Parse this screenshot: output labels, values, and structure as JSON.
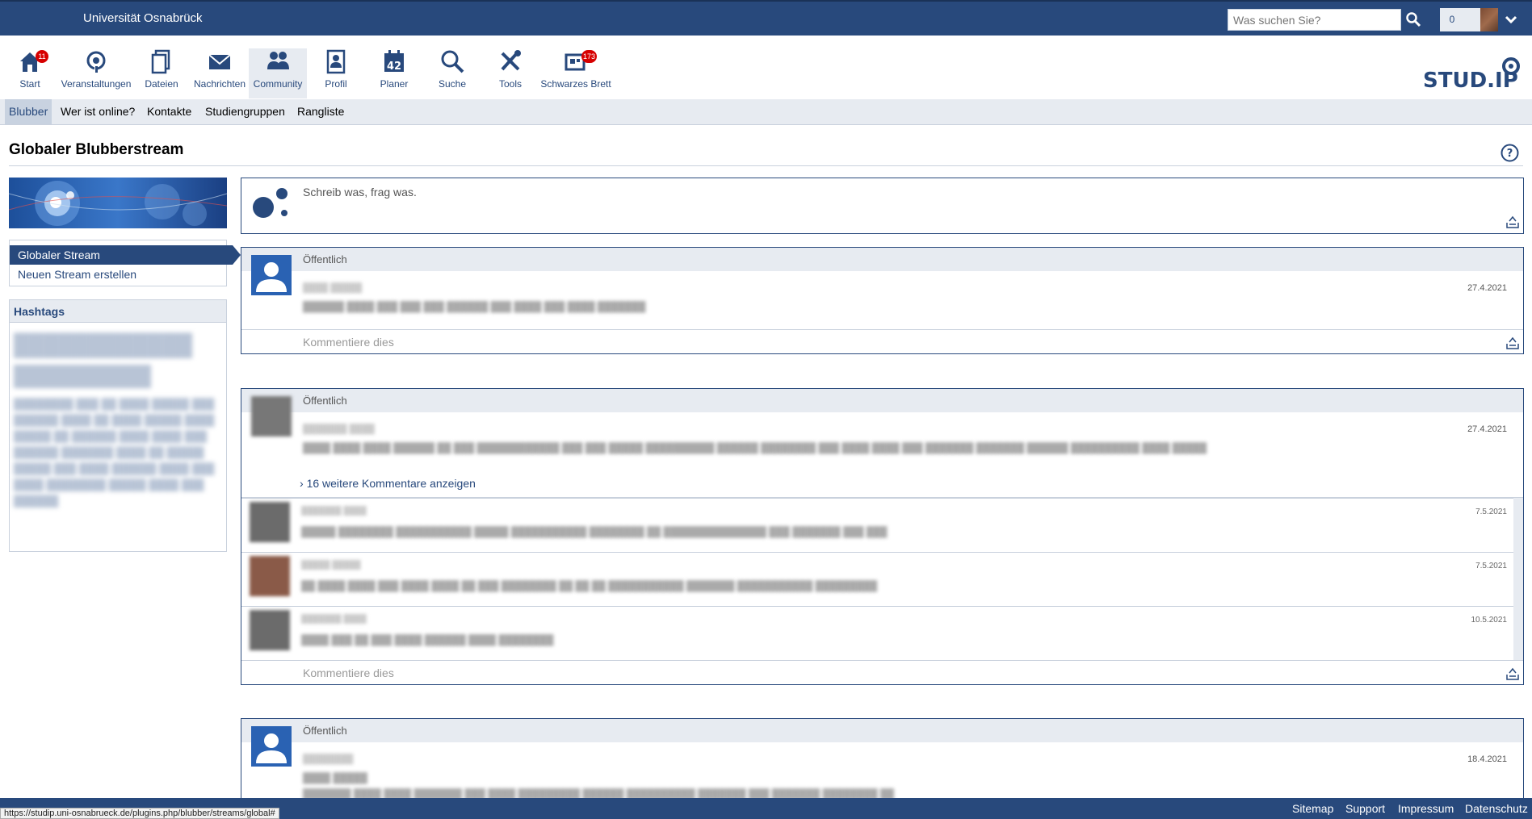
{
  "header": {
    "university": "Universität Osnabrück",
    "search_placeholder": "Was suchen Sie?",
    "notifications_count": "0"
  },
  "nav": {
    "items": [
      {
        "label": "Start",
        "icon": "home-icon",
        "badge": "11"
      },
      {
        "label": "Veranstaltungen",
        "icon": "seminar-icon"
      },
      {
        "label": "Dateien",
        "icon": "files-icon"
      },
      {
        "label": "Nachrichten",
        "icon": "mail-icon"
      },
      {
        "label": "Community",
        "icon": "community-icon",
        "active": true
      },
      {
        "label": "Profil",
        "icon": "profile-icon"
      },
      {
        "label": "Planer",
        "icon": "calendar-icon",
        "calendar_day": "42"
      },
      {
        "label": "Suche",
        "icon": "search-icon"
      },
      {
        "label": "Tools",
        "icon": "tools-icon"
      },
      {
        "label": "Schwarzes Brett",
        "icon": "board-icon",
        "badge": "173"
      }
    ],
    "logo": "STUD.IP"
  },
  "subnav": {
    "items": [
      "Blubber",
      "Wer ist online?",
      "Kontakte",
      "Studiengruppen",
      "Rangliste"
    ]
  },
  "page": {
    "title": "Globaler Blubberstream"
  },
  "sidebar": {
    "nav_current": "Globaler Stream",
    "nav_new": "Neuen Stream erstellen",
    "hashtags_title": "Hashtags"
  },
  "composer": {
    "placeholder": "Schreib was, frag was."
  },
  "posts": [
    {
      "visibility": "Öffentlich",
      "date": "27.4.2021",
      "comment_placeholder": "Kommentiere dies"
    },
    {
      "visibility": "Öffentlich",
      "date": "27.4.2021",
      "more_comments": "16 weitere Kommentare anzeigen",
      "comments": [
        {
          "date": "7.5.2021"
        },
        {
          "date": "7.5.2021"
        },
        {
          "date": "10.5.2021"
        }
      ],
      "comment_placeholder": "Kommentiere dies"
    },
    {
      "visibility": "Öffentlich",
      "date": "18.4.2021"
    }
  ],
  "footer": {
    "links": [
      "Sitemap",
      "Support",
      "Impressum",
      "Datenschutz"
    ],
    "status_url": "https://studip.uni-osnabrueck.de/plugins.php/blubber/streams/global#"
  },
  "colors": {
    "brand_blue": "#28497c",
    "light_blue": "#e7ebf1",
    "badge_red": "#d60000"
  }
}
